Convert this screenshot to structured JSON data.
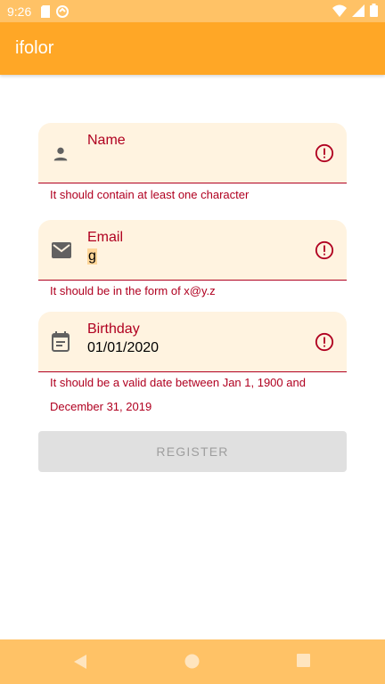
{
  "status_bar": {
    "time": "9:26"
  },
  "app_bar": {
    "title": "ifolor"
  },
  "form": {
    "name": {
      "label": "Name",
      "value": "",
      "error": "It should contain at least one character",
      "icon": "person-icon"
    },
    "email": {
      "label": "Email",
      "value": "g",
      "error": "It should be in the form of x@y.z",
      "icon": "mail-icon"
    },
    "birthday": {
      "label": "Birthday",
      "value": "01/01/2020",
      "error": "It should be a valid date between Jan 1, 1900 and December 31, 2019",
      "icon": "calendar-icon"
    },
    "register_label": "REGISTER"
  },
  "colors": {
    "status_bar": "#ffc266",
    "app_bar": "#ffa726",
    "field_bg": "#fff3e0",
    "error": "#b00020",
    "button_disabled": "#e0e0e0"
  }
}
